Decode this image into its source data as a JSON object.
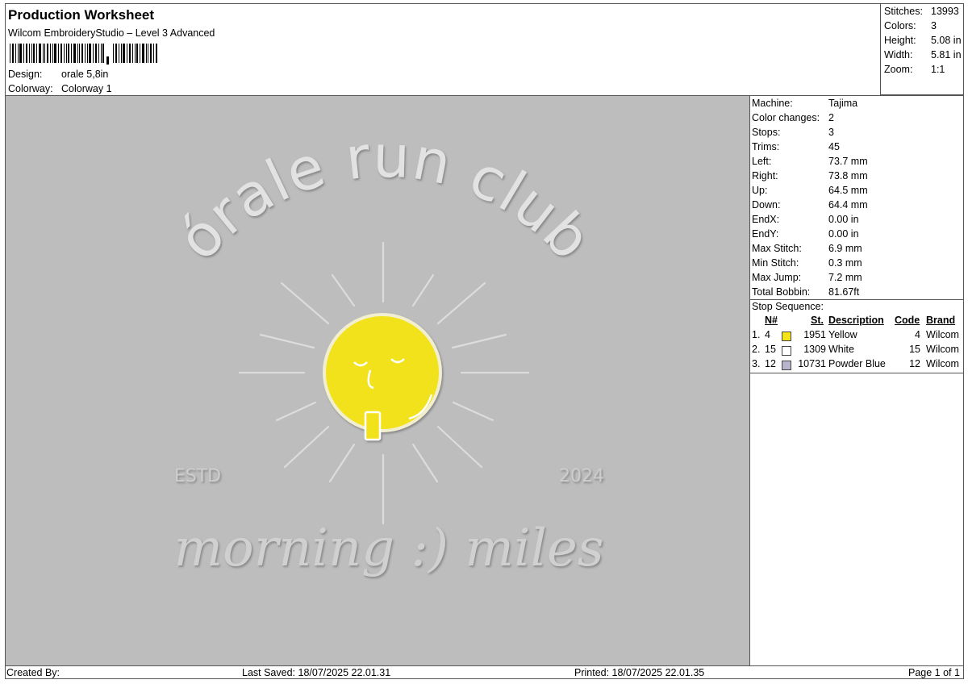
{
  "header": {
    "title": "Production Worksheet",
    "subtitle": "Wilcom EmbroideryStudio – Level 3 Advanced",
    "design_label": "Design:",
    "design_value": "orale 5,8in",
    "colorway_label": "Colorway:",
    "colorway_value": "Colorway 1"
  },
  "stats": [
    {
      "label": "Stitches:",
      "value": "13993"
    },
    {
      "label": "Colors:",
      "value": "3"
    },
    {
      "label": "Height:",
      "value": "5.08 in"
    },
    {
      "label": "Width:",
      "value": "5.81 in"
    },
    {
      "label": "Zoom:",
      "value": "1:1"
    }
  ],
  "design": {
    "arc_text": "órale run club",
    "estd": "ESTD",
    "year": "2024",
    "tagline": "morning :) miles",
    "colors": {
      "background": "#bdbdbd",
      "thread_white": "#eeeeee",
      "thread_yellow": "#f2e21a",
      "thread_grey": "#d6d6d6"
    }
  },
  "machine": [
    {
      "label": "Machine:",
      "value": "Tajima"
    },
    {
      "label": "Color changes:",
      "value": "2"
    },
    {
      "label": "Stops:",
      "value": "3"
    },
    {
      "label": "Trims:",
      "value": "45"
    },
    {
      "label": "Left:",
      "value": "73.7 mm"
    },
    {
      "label": "Right:",
      "value": "73.8 mm"
    },
    {
      "label": "Up:",
      "value": "64.5 mm"
    },
    {
      "label": "Down:",
      "value": "64.4 mm"
    },
    {
      "label": "EndX:",
      "value": "0.00 in"
    },
    {
      "label": "EndY:",
      "value": "0.00 in"
    },
    {
      "label": "Max Stitch:",
      "value": "6.9 mm"
    },
    {
      "label": "Min Stitch:",
      "value": "0.3 mm"
    },
    {
      "label": "Max Jump:",
      "value": "7.2 mm"
    },
    {
      "label": "Total Bobbin:",
      "value": "81.67ft"
    }
  ],
  "stop_sequence": {
    "title": "Stop Sequence:",
    "headers": {
      "n": "N#",
      "st": "St.",
      "description": "Description",
      "code": "Code",
      "brand": "Brand"
    },
    "rows": [
      {
        "idx": "1.",
        "n": "4",
        "color": "#f5e31a",
        "st": "1951",
        "description": "Yellow",
        "code": "4",
        "brand": "Wilcom"
      },
      {
        "idx": "2.",
        "n": "15",
        "color": "#ffffff",
        "st": "1309",
        "description": "White",
        "code": "15",
        "brand": "Wilcom"
      },
      {
        "idx": "3.",
        "n": "12",
        "color": "#b8b4cc",
        "st": "10731",
        "description": "Powder Blue",
        "code": "12",
        "brand": "Wilcom"
      }
    ]
  },
  "footer": {
    "created_by": "Created By:",
    "last_saved": "Last Saved: 18/07/2025 22.01.31",
    "printed": "Printed: 18/07/2025 22.01.35",
    "page": "Page 1 of 1"
  }
}
